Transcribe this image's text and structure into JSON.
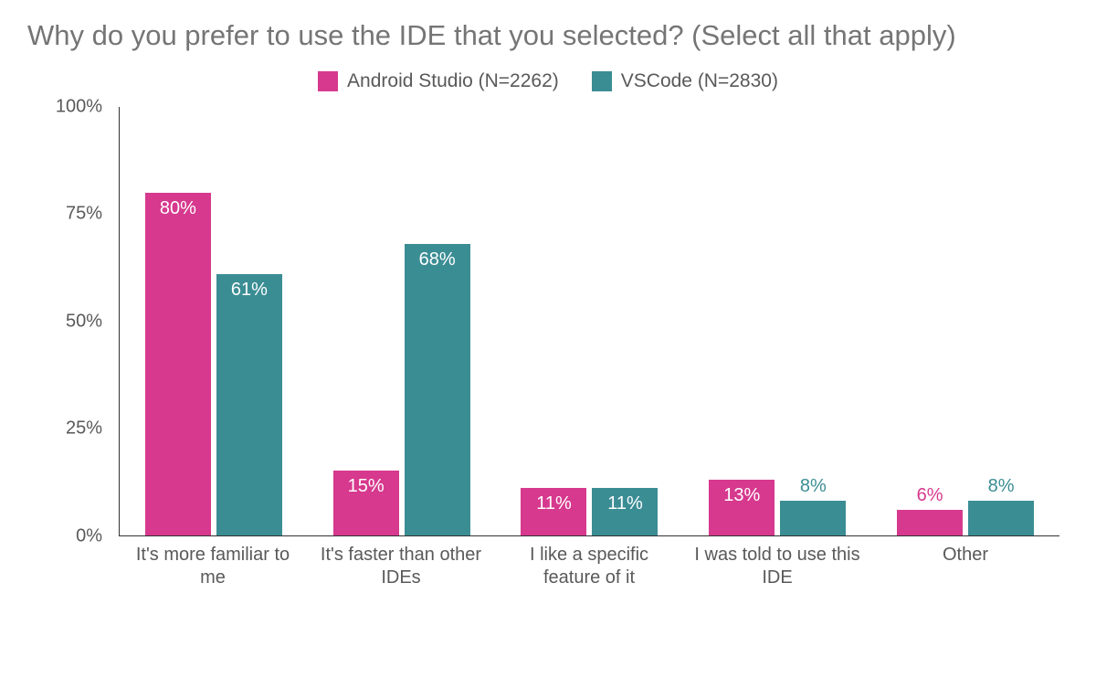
{
  "chart_data": {
    "type": "bar",
    "title": "Why do you prefer to use the IDE that you selected? (Select all that apply)",
    "categories": [
      "It's more familiar to me",
      "It's faster than other IDEs",
      "I like a specific feature of it",
      "I was told to use this IDE",
      "Other"
    ],
    "series": [
      {
        "name": "Android Studio (N=2262)",
        "color": "#d6398e",
        "values": [
          80,
          15,
          11,
          13,
          6
        ]
      },
      {
        "name": "VSCode (N=2830)",
        "color": "#3b8d94",
        "values": [
          61,
          68,
          11,
          8,
          8
        ]
      }
    ],
    "ylabel": "",
    "xlabel": "",
    "ylim": [
      0,
      100
    ],
    "y_ticks": [
      0,
      25,
      50,
      75,
      100
    ],
    "y_tick_format_suffix": "%",
    "value_label_suffix": "%",
    "label_inside_threshold": 10,
    "legend_position": "top-center"
  }
}
